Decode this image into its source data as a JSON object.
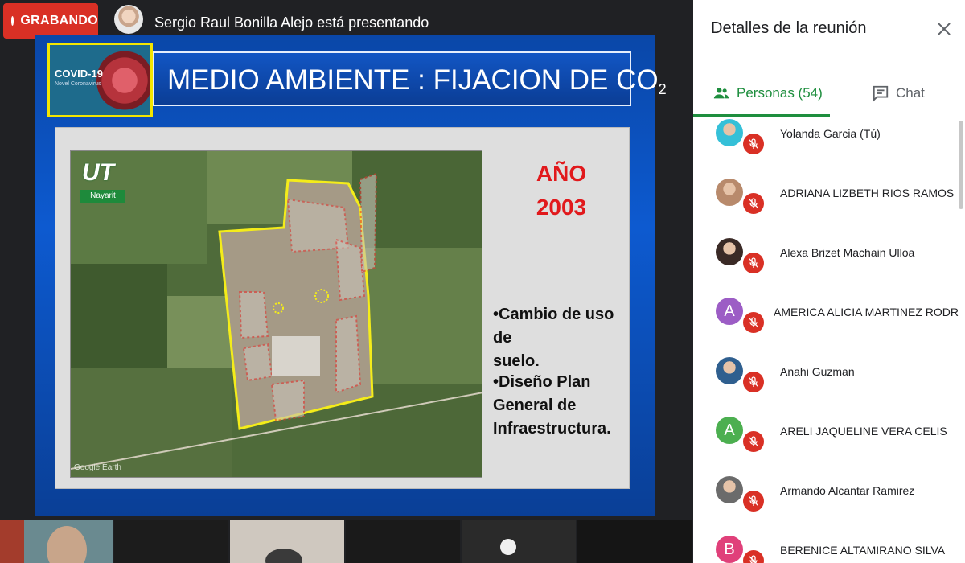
{
  "recording": {
    "label": "GRABANDO",
    "color": "#d93025"
  },
  "presenter": {
    "text": "Sergio Raul Bonilla Alejo está presentando"
  },
  "slide": {
    "badge_title": "COVID-19",
    "badge_subtitle": "Novel Coronavirus",
    "title_main": "MEDIO AMBIENTE : FIJACION DE CO",
    "title_subscript": "2",
    "logo_mark": "UT",
    "logo_label": "Nayarit",
    "map_watermark": "Google Earth",
    "year_line1": "AÑO",
    "year_line2": "2003",
    "bullet1_line1": "•Cambio de uso de",
    "bullet1_line2": "suelo.",
    "bullet2_line1": "•Diseño  Plan",
    "bullet2_line2": "General de",
    "bullet2_line3": "Infraestructura."
  },
  "panel": {
    "title": "Detalles de la reunión",
    "tabs": [
      {
        "label": "Personas (54)",
        "icon": "people-icon",
        "active": true
      },
      {
        "label": "Chat",
        "icon": "chat-icon",
        "active": false
      }
    ],
    "participants": [
      {
        "name": "Yolanda Garcia (Tú)",
        "avatar": "photo",
        "color": "#35c0d8",
        "muted": true
      },
      {
        "name": "ADRIANA LIZBETH RIOS RAMOS",
        "avatar": "photo",
        "color": "#b88a6c",
        "muted": true
      },
      {
        "name": "Alexa Brizet Machain Ulloa",
        "avatar": "photo",
        "color": "#3a2a26",
        "muted": true
      },
      {
        "name": "AMERICA ALICIA MARTINEZ RODRIG...",
        "avatar": "A",
        "color": "#9c5dc5",
        "muted": true
      },
      {
        "name": "Anahi Guzman",
        "avatar": "photo",
        "color": "#2f5f8f",
        "muted": true
      },
      {
        "name": "ARELI JAQUELINE VERA CELIS",
        "avatar": "A",
        "color": "#4caf50",
        "muted": true
      },
      {
        "name": "Armando Alcantar Ramirez",
        "avatar": "photo",
        "color": "#6b6b6b",
        "muted": true
      },
      {
        "name": "BERENICE ALTAMIRANO SILVA",
        "avatar": "B",
        "color": "#e0407a",
        "muted": true
      }
    ]
  }
}
